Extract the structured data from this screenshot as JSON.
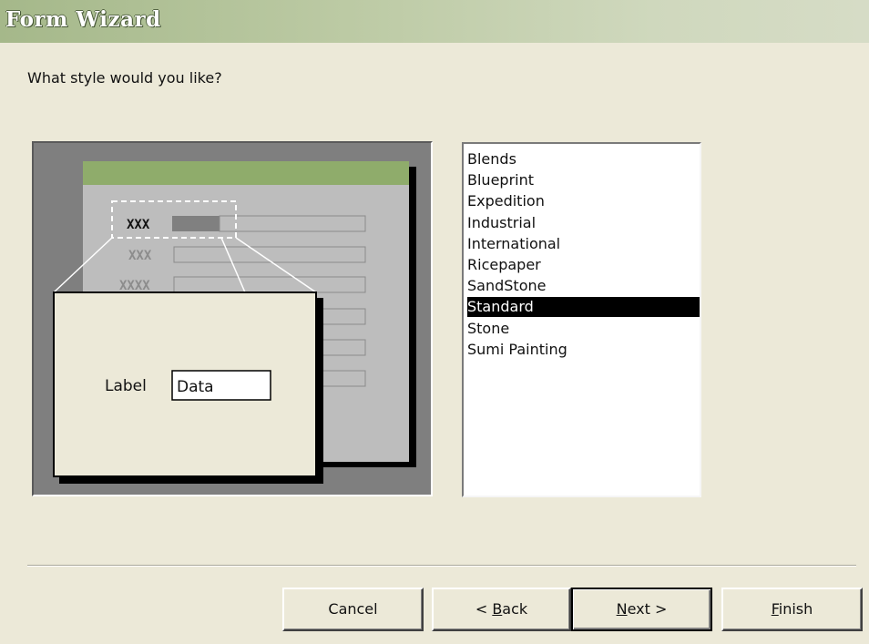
{
  "window": {
    "title": "Form Wizard"
  },
  "prompt": "What style would you like?",
  "preview": {
    "sample_fields": [
      "XXX",
      "XXX",
      "XXXX"
    ],
    "zoom_label": "Label",
    "zoom_data": "Data"
  },
  "styles": {
    "items": [
      "Blends",
      "Blueprint",
      "Expedition",
      "Industrial",
      "International",
      "Ricepaper",
      "SandStone",
      "Standard",
      "Stone",
      "Sumi Painting"
    ],
    "selected": "Standard"
  },
  "buttons": {
    "cancel": "Cancel",
    "back": {
      "prefix": "< ",
      "mnemonic": "B",
      "rest": "ack"
    },
    "next": {
      "mnemonic": "N",
      "rest": "ext >"
    },
    "finish": {
      "mnemonic": "F",
      "rest": "inish"
    }
  },
  "colors": {
    "title_gradient_start": "#a5b88a",
    "preview_header": "#8fac6b",
    "selection": "#000000"
  }
}
